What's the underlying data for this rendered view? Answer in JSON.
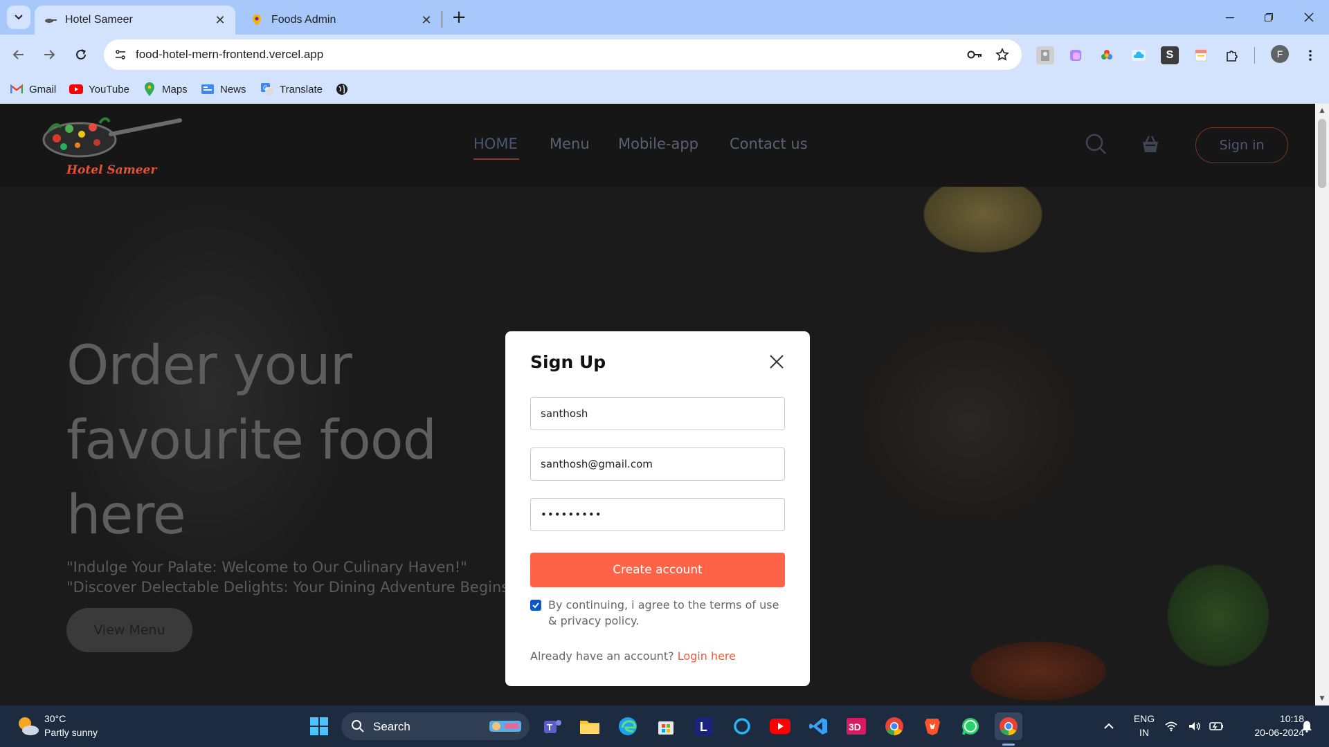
{
  "browser": {
    "tabs": [
      {
        "title": "Hotel Sameer",
        "active": true
      },
      {
        "title": "Foods Admin",
        "active": false
      }
    ],
    "url": "food-hotel-mern-frontend.vercel.app",
    "bookmarks": [
      "Gmail",
      "YouTube",
      "Maps",
      "News",
      "Translate"
    ],
    "profile_initial": "F"
  },
  "site": {
    "logo_text": "Hotel Sameer",
    "nav": [
      "HOME",
      "Menu",
      "Mobile-app",
      "Contact us"
    ],
    "signin_label": "Sign in",
    "hero": {
      "title": "Order your favourite food here",
      "subtitle": "\"Indulge Your Palate: Welcome to Our Culinary Haven!\" \"Discover Delectable Delights: Your Dining Adventure Begins Here!\"",
      "button": "View Menu"
    }
  },
  "modal": {
    "title": "Sign Up",
    "name_value": "santhosh",
    "email_value": "santhosh@gmail.com",
    "password_value": "•••••••••",
    "submit_label": "Create account",
    "terms_text": "By continuing, i agree to the terms of use & privacy policy.",
    "terms_checked": true,
    "login_prompt": "Already have an account?",
    "login_link": "Login here"
  },
  "taskbar": {
    "weather_temp": "30°C",
    "weather_desc": "Partly sunny",
    "search_label": "Search",
    "lang_top": "ENG",
    "lang_bottom": "IN",
    "time": "10:18",
    "date": "20-06-2024"
  },
  "colors": {
    "accent": "#ff6347",
    "chrome_tabstrip": "#a8c7fa",
    "chrome_toolbar": "#d3e3fd",
    "taskbar": "#1c2b3f"
  }
}
